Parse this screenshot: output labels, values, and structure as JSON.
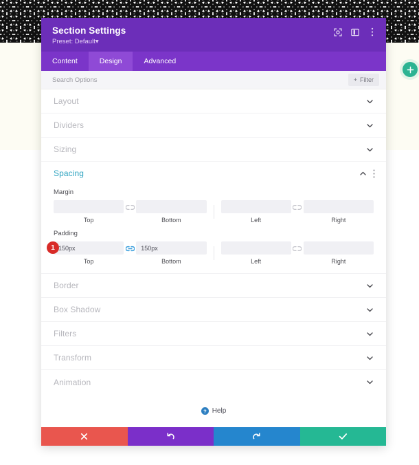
{
  "window": {
    "title": "Section Settings",
    "preset": "Preset: Default",
    "preset_caret": "▾"
  },
  "header_icons": [
    {
      "name": "fullscreen-icon"
    },
    {
      "name": "panel-layout-icon"
    },
    {
      "name": "more-options-icon"
    }
  ],
  "tabs": [
    {
      "label": "Content",
      "active": false
    },
    {
      "label": "Design",
      "active": true
    },
    {
      "label": "Advanced",
      "active": false
    }
  ],
  "search": {
    "placeholder": "Search Options",
    "value": "",
    "filter_label": "Filter",
    "filter_plus": "+"
  },
  "sections_above": [
    {
      "label": "Layout",
      "state": "collapsed"
    },
    {
      "label": "Dividers",
      "state": "collapsed"
    },
    {
      "label": "Sizing",
      "state": "collapsed"
    }
  ],
  "spacing": {
    "title": "Spacing",
    "state": "expanded",
    "margin": {
      "label": "Margin",
      "linked_top_bottom": false,
      "linked_left_right": false,
      "fields": [
        {
          "caption": "Top",
          "value": "",
          "placeholder": ""
        },
        {
          "caption": "Bottom",
          "value": "",
          "placeholder": ""
        },
        {
          "caption": "Left",
          "value": "",
          "placeholder": ""
        },
        {
          "caption": "Right",
          "value": "",
          "placeholder": ""
        }
      ]
    },
    "padding": {
      "label": "Padding",
      "linked_top_bottom": true,
      "linked_left_right": false,
      "badge": "1",
      "fields": [
        {
          "caption": "Top",
          "value": "150px",
          "placeholder": ""
        },
        {
          "caption": "Bottom",
          "value": "150px",
          "placeholder": ""
        },
        {
          "caption": "Left",
          "value": "",
          "placeholder": ""
        },
        {
          "caption": "Right",
          "value": "",
          "placeholder": ""
        }
      ]
    }
  },
  "sections_below": [
    {
      "label": "Border",
      "state": "collapsed"
    },
    {
      "label": "Box Shadow",
      "state": "collapsed"
    },
    {
      "label": "Filters",
      "state": "collapsed"
    },
    {
      "label": "Transform",
      "state": "collapsed"
    },
    {
      "label": "Animation",
      "state": "collapsed"
    }
  ],
  "help": {
    "label": "Help"
  },
  "footer_buttons": [
    {
      "name": "cancel-button",
      "glyph": "✖",
      "color": "#e9564e"
    },
    {
      "name": "undo-button",
      "glyph": "↺",
      "color": "#7b2fc9"
    },
    {
      "name": "redo-button",
      "glyph": "↻",
      "color": "#2586ce"
    },
    {
      "name": "save-button",
      "glyph": "✔",
      "color": "#25b894"
    }
  ],
  "canvas": {
    "add_section_button": "+"
  },
  "colors": {
    "header_purple": "#6c2eb9",
    "tabs_purple": "#7b35c9",
    "tab_active_purple": "#8f4ad6",
    "spacing_teal": "#2ea3c0",
    "badge_red": "#d82b28",
    "link_active_blue": "#3b9fdd",
    "add_green": "#2cb392"
  }
}
